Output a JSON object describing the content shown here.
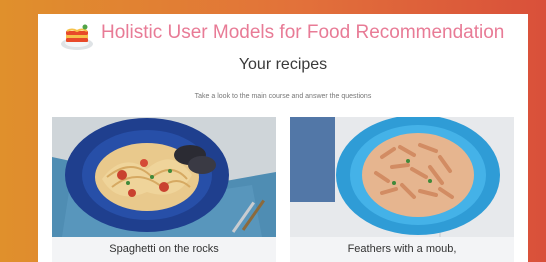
{
  "header": {
    "app_title": "Holistic User Models for Food Recommendation",
    "logo_icon": "lasagna-plate-icon"
  },
  "main": {
    "page_title": "Your recipes",
    "instruction": "Take a look to the main course and answer the questions",
    "recipes": [
      {
        "name": "Spaghetti on the rocks",
        "image": "spaghetti-plate-image"
      },
      {
        "name": "Feathers with a moub,",
        "image": "penne-plate-image"
      }
    ]
  },
  "colors": {
    "background_gradient": [
      "#e0902c",
      "#e2713a",
      "#d9503a"
    ],
    "title_pink": "#e87b96"
  }
}
